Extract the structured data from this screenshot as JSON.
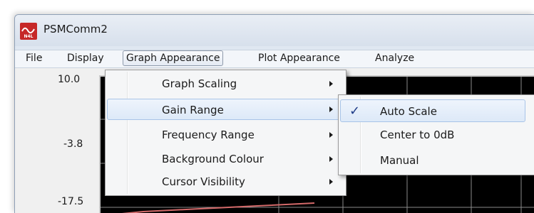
{
  "window": {
    "title": "PSMComm2",
    "icon": "n4l-app-icon",
    "icon_text": "N4L"
  },
  "menubar": {
    "items": [
      {
        "label": "File"
      },
      {
        "label": "Display"
      },
      {
        "label": "Graph Appearance",
        "active": true
      },
      {
        "label": "Plot Appearance"
      },
      {
        "label": "Analyze"
      }
    ]
  },
  "graph": {
    "y_ticks": [
      "10.0",
      "-3.8",
      "-17.5"
    ],
    "background": "#000000",
    "grid_color": "#c8c8c8",
    "trace_color": "#d46a6a"
  },
  "graph_appearance_menu": {
    "items": [
      {
        "label": "Graph Scaling",
        "has_submenu": true
      },
      {
        "label": "Gain Range",
        "has_submenu": true,
        "highlighted": true
      },
      {
        "label": "Frequency Range",
        "has_submenu": true
      },
      {
        "label": "Background Colour",
        "has_submenu": true
      },
      {
        "label": "Cursor Visibility",
        "has_submenu": true
      }
    ]
  },
  "gain_range_submenu": {
    "items": [
      {
        "label": "Auto Scale",
        "checked": true,
        "check_glyph": "✓",
        "highlighted": true
      },
      {
        "label": "Center to 0dB",
        "checked": false
      },
      {
        "label": "Manual",
        "checked": false
      }
    ]
  },
  "colors": {
    "menu_highlight": "#dde9f8",
    "highlight_border": "#a8c4e8",
    "checkmark": "#1f3c88",
    "window_chrome": "#dfe7f1"
  }
}
